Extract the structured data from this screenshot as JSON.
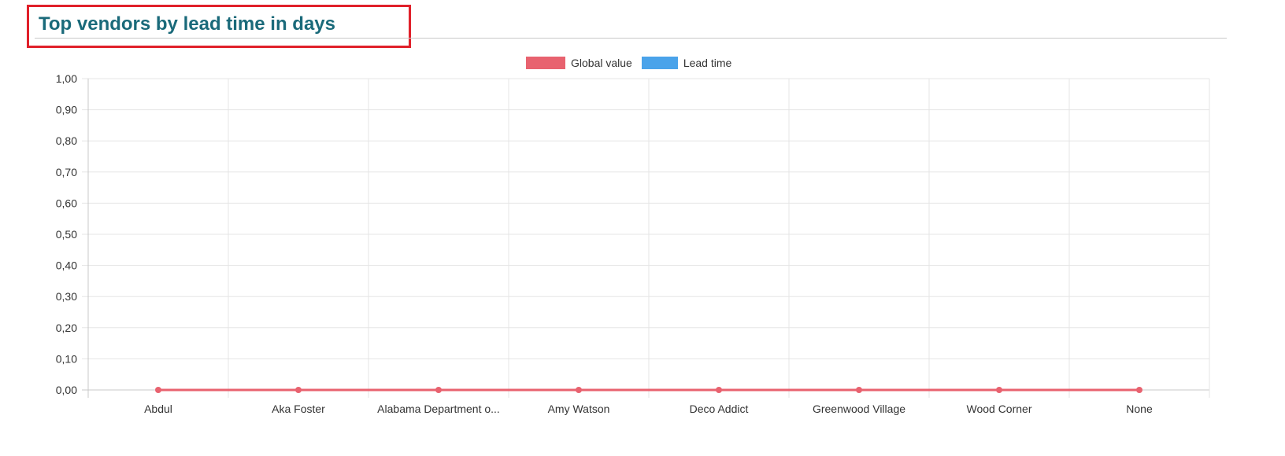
{
  "header": {
    "title": "Top vendors by lead time in days"
  },
  "colors": {
    "global_value": "#e8626f",
    "lead_time": "#4aa3ea",
    "title": "#1a6a7a",
    "highlight_border": "#e0202a"
  },
  "chart_data": {
    "type": "line",
    "categories": [
      "Abdul",
      "Aka Foster",
      "Alabama Department o...",
      "Amy Watson",
      "Deco Addict",
      "Greenwood Village",
      "Wood Corner",
      "None"
    ],
    "series": [
      {
        "name": "Global value",
        "values": [
          0,
          0,
          0,
          0,
          0,
          0,
          0,
          0
        ]
      },
      {
        "name": "Lead time",
        "values": []
      }
    ],
    "y_ticks": [
      "0,00",
      "0,10",
      "0,20",
      "0,30",
      "0,40",
      "0,50",
      "0,60",
      "0,70",
      "0,80",
      "0,90",
      "1,00"
    ],
    "ylim": [
      0,
      1
    ],
    "grid": true,
    "legend_position": "top"
  }
}
